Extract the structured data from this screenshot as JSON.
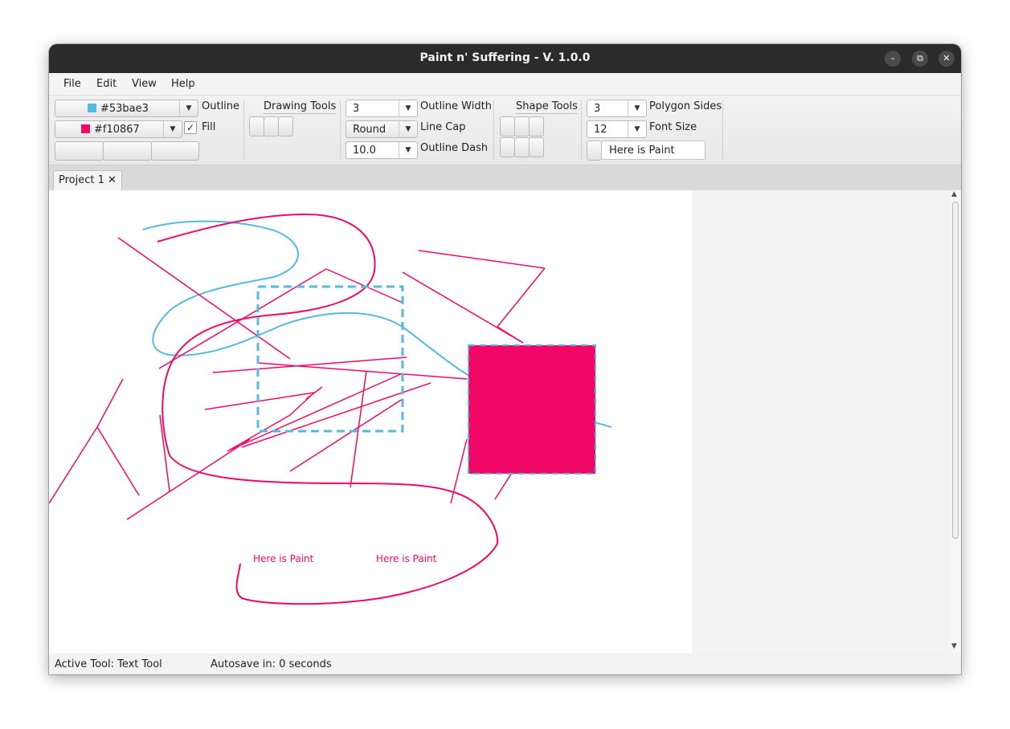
{
  "window": {
    "title": "Paint n' Suffering - V. 1.0.0"
  },
  "menu": [
    "File",
    "Edit",
    "View",
    "Help"
  ],
  "toolbar": {
    "outline_color": {
      "value": "#53bae3",
      "label": "Outline"
    },
    "fill_color": {
      "value": "#f10867",
      "label": "Fill",
      "checked": true
    },
    "drawing_tools_title": "Drawing Tools",
    "outline_width": {
      "value": "3",
      "label": "Outline Width"
    },
    "line_cap": {
      "value": "Round",
      "label": "Line Cap"
    },
    "outline_dash": {
      "value": "10.0",
      "label": "Outline Dash"
    },
    "shape_tools_title": "Shape Tools",
    "polygon_sides": {
      "value": "3",
      "label": "Polygon Sides"
    },
    "font_size": {
      "value": "12",
      "label": "Font Size"
    },
    "text_input": {
      "value": "Here is Paint"
    }
  },
  "tabs": [
    {
      "label": "Project 1",
      "close": "✕"
    }
  ],
  "canvas": {
    "texts": [
      "Here is Paint",
      "Here is Paint"
    ],
    "colors": {
      "outline": "#53bae3",
      "fill": "#f10867"
    }
  },
  "status": {
    "active_tool": "Active Tool: Text Tool",
    "autosave": "Autosave in: 0 seconds"
  },
  "icons": {
    "minimize": "minimize-icon",
    "maximize": "maximize-icon",
    "close": "close-icon",
    "dropdown": "chevron-down-icon"
  }
}
